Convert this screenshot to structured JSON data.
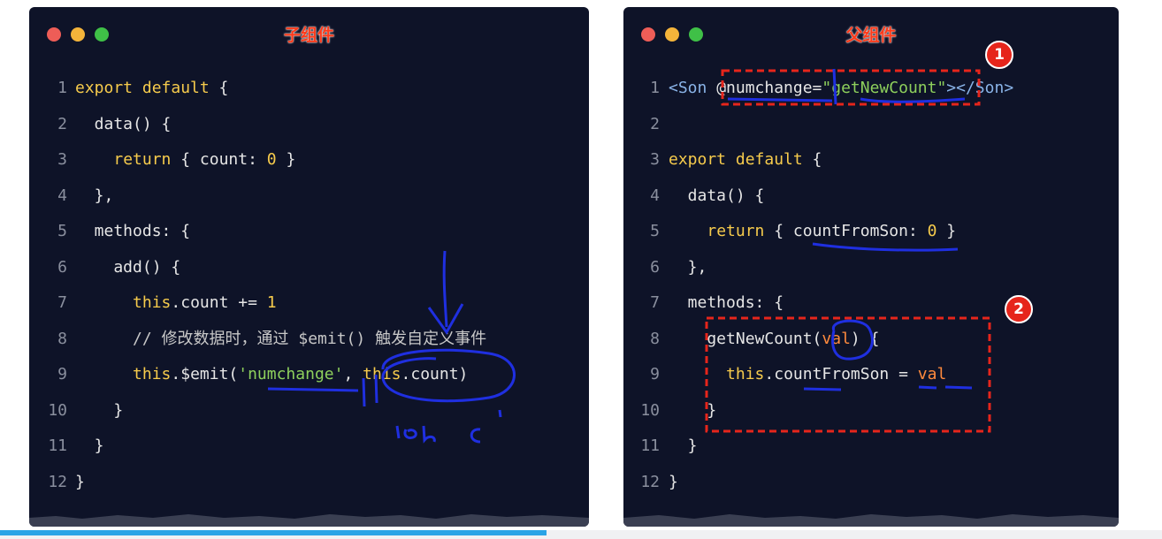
{
  "left_panel": {
    "title": "子组件",
    "lines": [
      {
        "num": "1",
        "tokens": [
          {
            "t": "kw",
            "v": "export default"
          },
          {
            "t": "plain",
            "v": " {"
          }
        ]
      },
      {
        "num": "2",
        "tokens": [
          {
            "t": "plain",
            "v": "  data() {"
          }
        ]
      },
      {
        "num": "3",
        "tokens": [
          {
            "t": "plain",
            "v": "    "
          },
          {
            "t": "kw",
            "v": "return"
          },
          {
            "t": "plain",
            "v": " { count: "
          },
          {
            "t": "num",
            "v": "0"
          },
          {
            "t": "plain",
            "v": " }"
          }
        ]
      },
      {
        "num": "4",
        "tokens": [
          {
            "t": "plain",
            "v": "  },"
          }
        ]
      },
      {
        "num": "5",
        "tokens": [
          {
            "t": "plain",
            "v": "  methods: {"
          }
        ]
      },
      {
        "num": "6",
        "tokens": [
          {
            "t": "plain",
            "v": "    add() {"
          }
        ]
      },
      {
        "num": "7",
        "tokens": [
          {
            "t": "plain",
            "v": "      "
          },
          {
            "t": "kw",
            "v": "this"
          },
          {
            "t": "plain",
            "v": ".count += "
          },
          {
            "t": "num",
            "v": "1"
          }
        ]
      },
      {
        "num": "8",
        "tokens": [
          {
            "t": "cm",
            "v": "      // 修改数据时，通过 $emit() 触发自定义事件"
          }
        ]
      },
      {
        "num": "9",
        "tokens": [
          {
            "t": "plain",
            "v": "      "
          },
          {
            "t": "kw",
            "v": "this"
          },
          {
            "t": "plain",
            "v": ".$emit("
          },
          {
            "t": "str",
            "v": "'numchange'"
          },
          {
            "t": "plain",
            "v": ", "
          },
          {
            "t": "kw",
            "v": "this"
          },
          {
            "t": "plain",
            "v": ".count)"
          }
        ]
      },
      {
        "num": "10",
        "tokens": [
          {
            "t": "plain",
            "v": "    }"
          }
        ]
      },
      {
        "num": "11",
        "tokens": [
          {
            "t": "plain",
            "v": "  }"
          }
        ]
      },
      {
        "num": "12",
        "tokens": [
          {
            "t": "plain",
            "v": "}"
          }
        ]
      }
    ]
  },
  "right_panel": {
    "title": "父组件",
    "badges": [
      "1",
      "2"
    ],
    "lines": [
      {
        "num": "1",
        "tokens": [
          {
            "t": "tag",
            "v": "<Son "
          },
          {
            "t": "plain",
            "v": "@numchange="
          },
          {
            "t": "str",
            "v": "\"getNewCount\""
          },
          {
            "t": "tag",
            "v": "></Son>"
          }
        ]
      },
      {
        "num": "2",
        "tokens": []
      },
      {
        "num": "3",
        "tokens": [
          {
            "t": "kw",
            "v": "export default"
          },
          {
            "t": "plain",
            "v": " {"
          }
        ]
      },
      {
        "num": "4",
        "tokens": [
          {
            "t": "plain",
            "v": "  data() {"
          }
        ]
      },
      {
        "num": "5",
        "tokens": [
          {
            "t": "plain",
            "v": "    "
          },
          {
            "t": "kw",
            "v": "return"
          },
          {
            "t": "plain",
            "v": " { countFromSon: "
          },
          {
            "t": "num",
            "v": "0"
          },
          {
            "t": "plain",
            "v": " }"
          }
        ]
      },
      {
        "num": "6",
        "tokens": [
          {
            "t": "plain",
            "v": "  },"
          }
        ]
      },
      {
        "num": "7",
        "tokens": [
          {
            "t": "plain",
            "v": "  methods: {"
          }
        ]
      },
      {
        "num": "8",
        "tokens": [
          {
            "t": "plain",
            "v": "    getNewCount("
          },
          {
            "t": "val",
            "v": "val"
          },
          {
            "t": "plain",
            "v": ") {"
          }
        ]
      },
      {
        "num": "9",
        "tokens": [
          {
            "t": "plain",
            "v": "      "
          },
          {
            "t": "kw",
            "v": "this"
          },
          {
            "t": "plain",
            "v": ".countFromSon = "
          },
          {
            "t": "val",
            "v": "val"
          }
        ]
      },
      {
        "num": "10",
        "tokens": [
          {
            "t": "plain",
            "v": "    }"
          }
        ]
      },
      {
        "num": "11",
        "tokens": [
          {
            "t": "plain",
            "v": "  }"
          }
        ]
      },
      {
        "num": "12",
        "tokens": [
          {
            "t": "plain",
            "v": "}"
          }
        ]
      }
    ]
  },
  "video_progress": {
    "fraction": 0.47
  },
  "colors": {
    "panel_bg": "#0e1328",
    "keyword": "#f6cb4c",
    "string": "#8ed05c",
    "title_red": "#ff3a1a",
    "annotation_blue": "#1f2fe0",
    "dashed_red": "#e6251b",
    "progress_blue": "#2aa4e6"
  },
  "icons": [
    "window-close-dot-icon",
    "window-minimize-dot-icon",
    "window-zoom-dot-icon"
  ]
}
